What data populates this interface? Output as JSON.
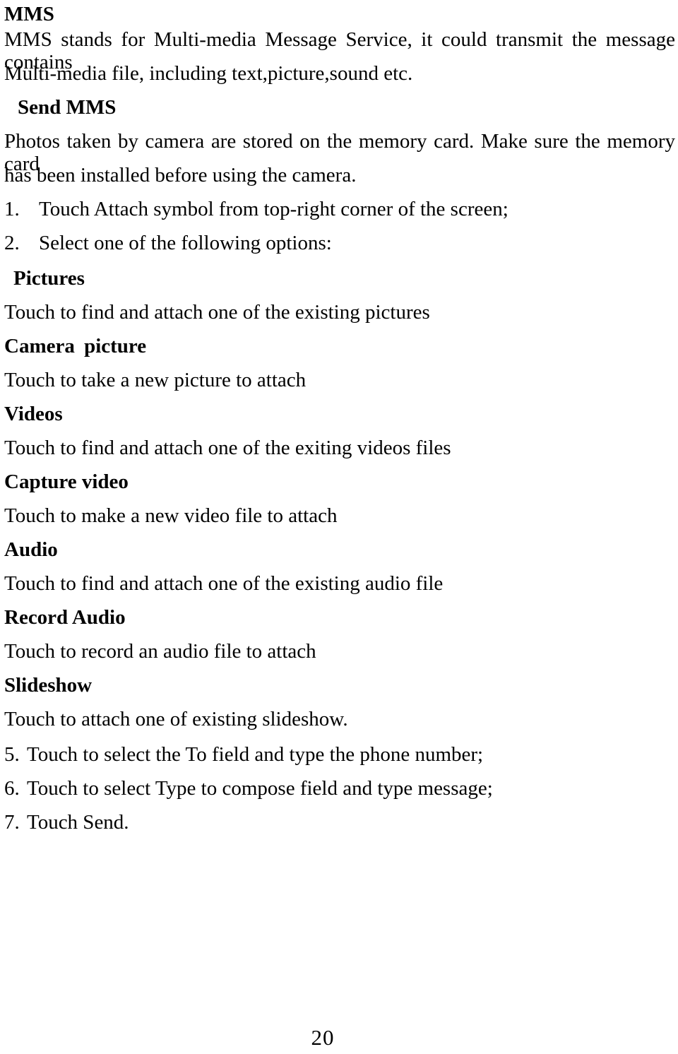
{
  "document": {
    "page_number": "20",
    "heading": "MMS",
    "intro_paragraph": "MMS stands for Multi-media Message Service, it could transmit the message contains Multi-media file, including text,picture,sound etc.",
    "intro_lines": [
      "MMS stands for Multi-media Message Service, it could transmit the message contains",
      "Multi-media file, including text,picture,sound etc."
    ],
    "section_heading": "Send MMS",
    "note_lines": [
      "Photos taken by camera are stored on the memory card. Make sure the memory card",
      "has been installed before using the camera."
    ],
    "steps_top": [
      {
        "number": "1.",
        "text": "Touch Attach symbol from top-right corner of the screen;"
      },
      {
        "number": "2.",
        "text": "Select one of the following options:"
      }
    ],
    "options": [
      {
        "title": "Pictures",
        "description": "Touch to find and attach one of the existing pictures"
      },
      {
        "title": "Camera picture",
        "description": "Touch to take a new picture to attach"
      },
      {
        "title": "Videos",
        "description": "Touch to find and attach one of the exiting videos files"
      },
      {
        "title": "Capture video",
        "description": "Touch to make a new video file to attach"
      },
      {
        "title": "Audio",
        "description": "Touch to find and attach one of the existing audio file"
      },
      {
        "title": "Record Audio",
        "description": "Touch to record an audio file to attach"
      },
      {
        "title": "Slideshow",
        "description": "Touch to attach one of existing slideshow."
      }
    ],
    "steps_bottom": [
      {
        "number": "5.",
        "text": "Touch to select the To field and type the phone number;"
      },
      {
        "number": "6.",
        "text": "Touch to select Type to compose field and type message;"
      },
      {
        "number": "7.",
        "text": "Touch Send."
      }
    ]
  }
}
